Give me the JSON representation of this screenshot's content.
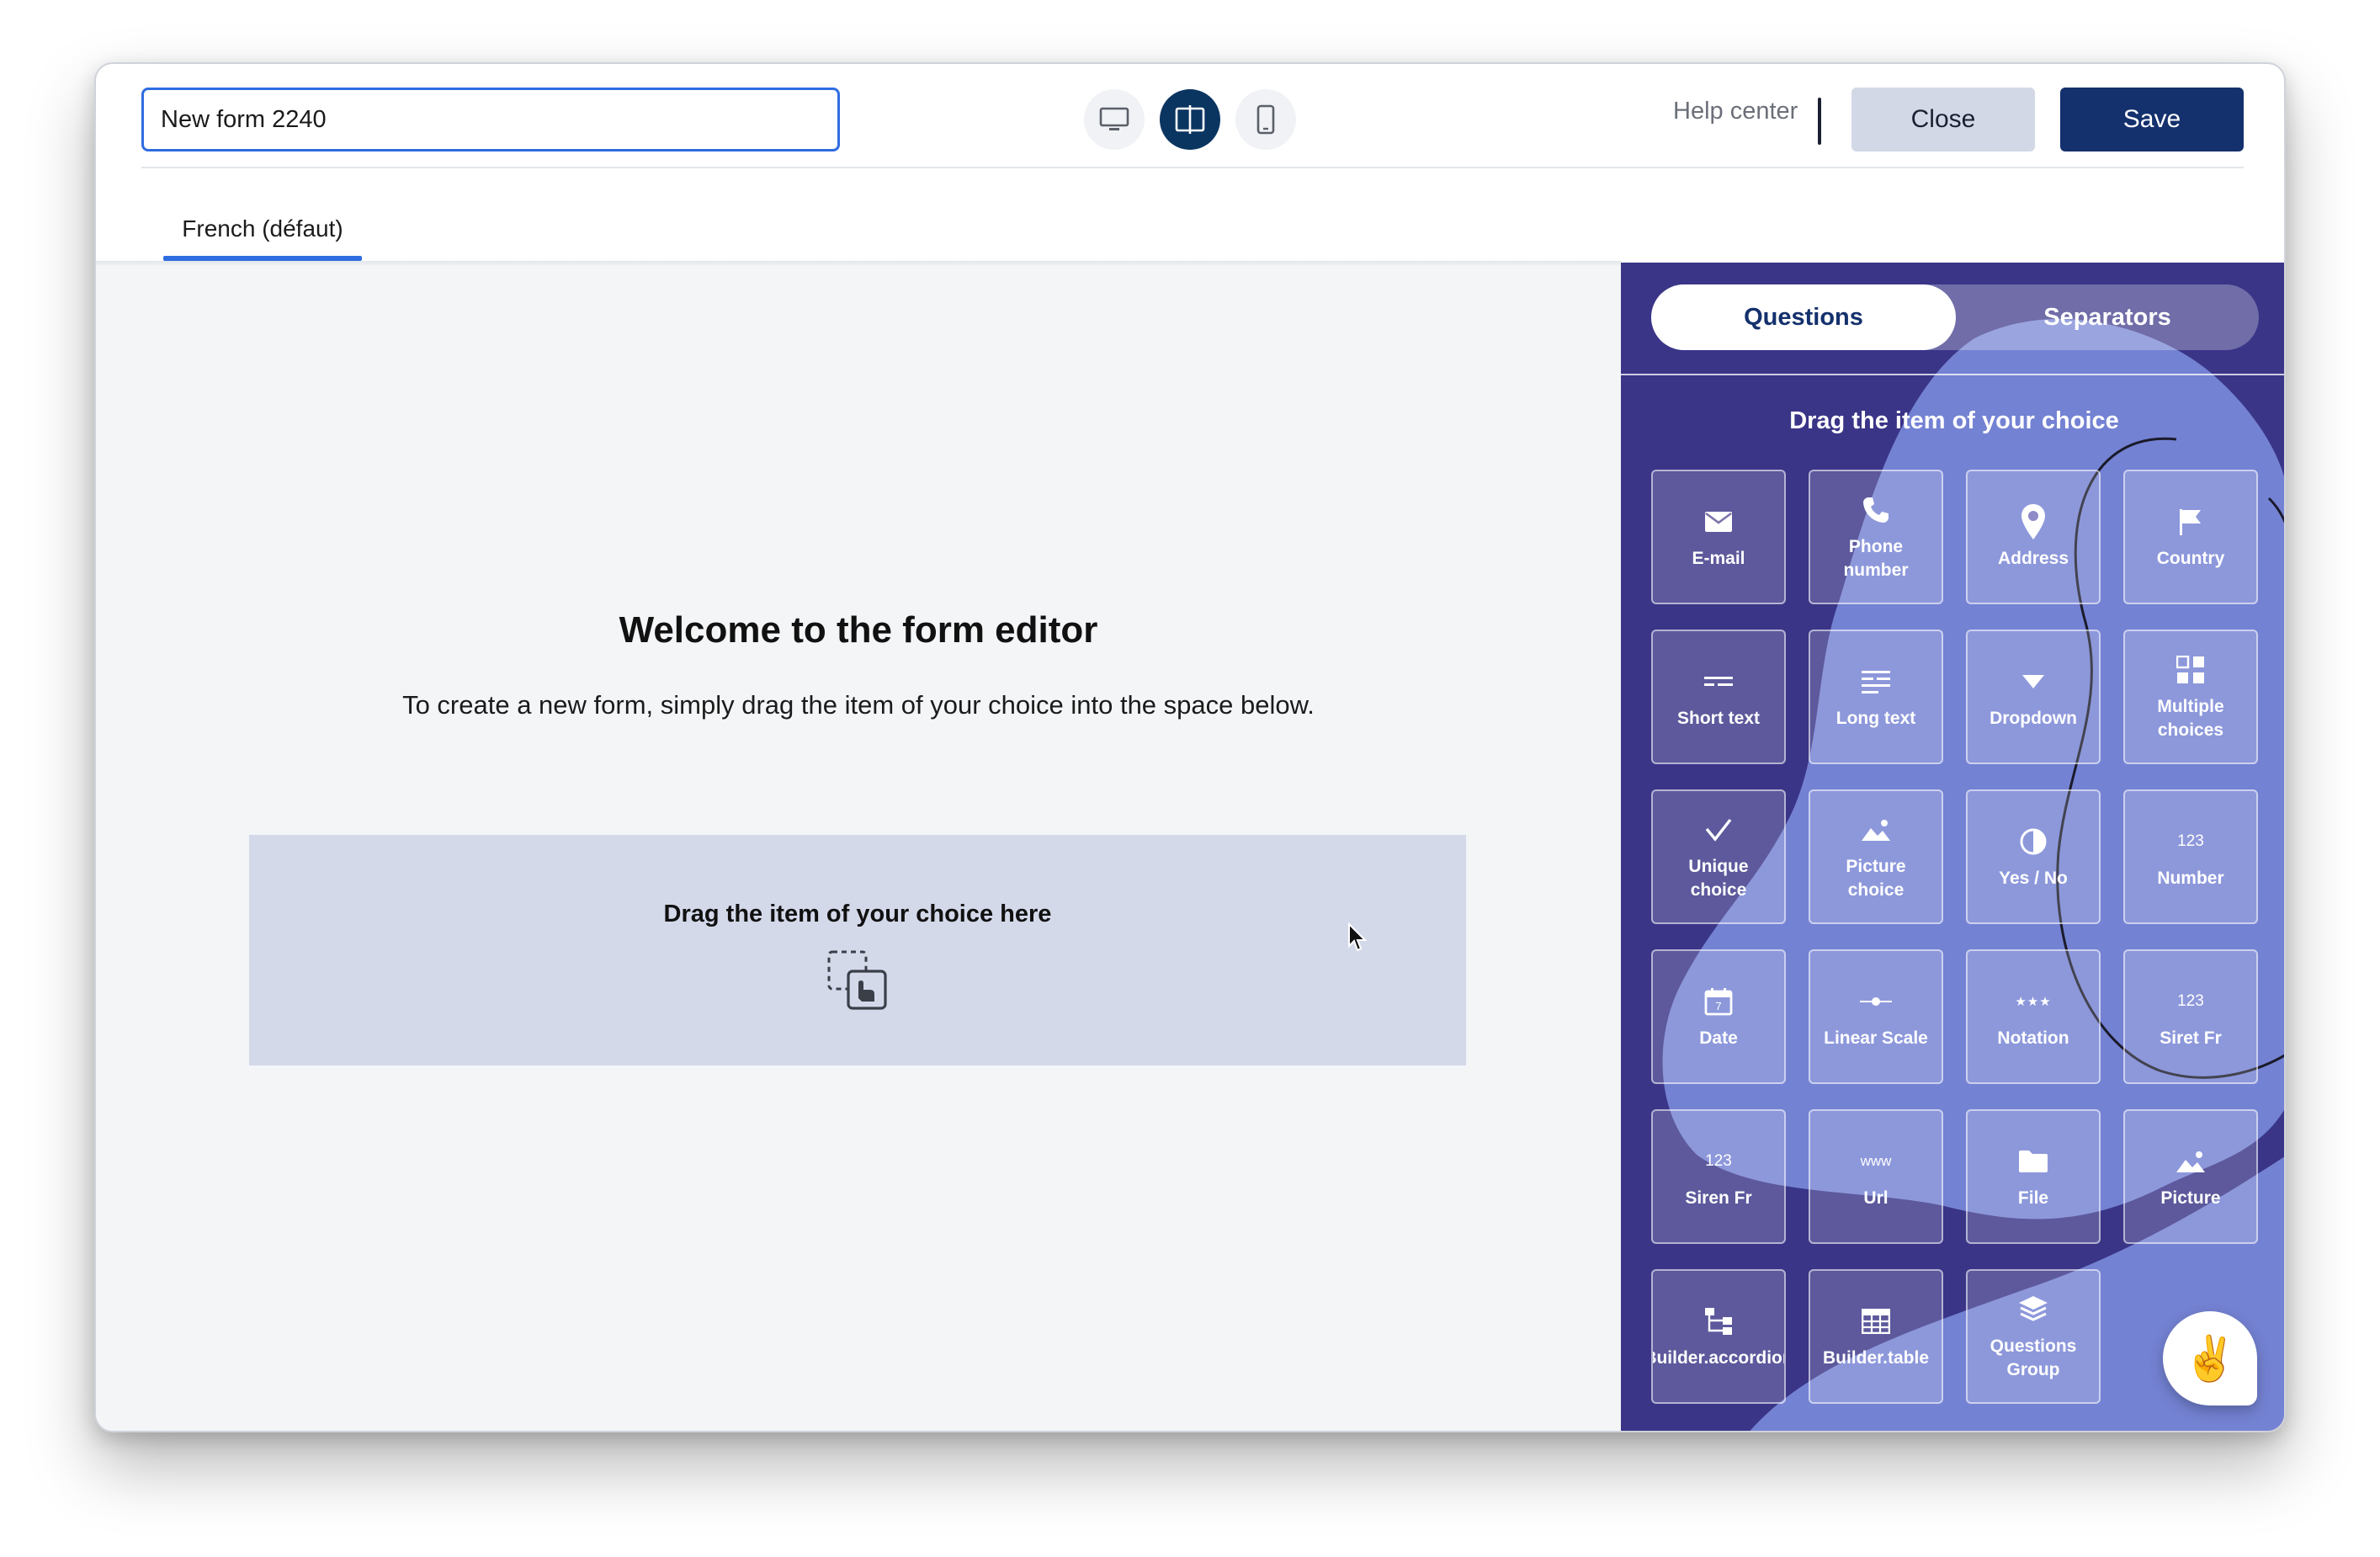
{
  "form": {
    "title_value": "New form 2240"
  },
  "header": {
    "help_label": "Help center",
    "close_label": "Close",
    "save_label": "Save",
    "view_modes": [
      "desktop-icon",
      "split-view-icon",
      "mobile-icon"
    ],
    "active_view": "split-view-icon"
  },
  "language_tab": {
    "label": "French (défaut)"
  },
  "canvas": {
    "title": "Welcome to the form editor",
    "subtitle": "To create a new form, simply drag the item of your choice into the space below.",
    "dropzone_label": "Drag the item of your choice here"
  },
  "sidebar": {
    "tabs": [
      {
        "label": "Questions",
        "active": true
      },
      {
        "label": "Separators",
        "active": false
      }
    ],
    "heading": "Drag the item of your choice",
    "items": [
      {
        "label": "E-mail",
        "icon": "envelope-icon"
      },
      {
        "label": "Phone\nnumber",
        "icon": "phone-icon"
      },
      {
        "label": "Address",
        "icon": "location-pin-icon"
      },
      {
        "label": "Country",
        "icon": "flag-icon"
      },
      {
        "label": "Short text",
        "icon": "short-text-icon"
      },
      {
        "label": "Long text",
        "icon": "long-text-icon"
      },
      {
        "label": "Dropdown",
        "icon": "caret-down-icon"
      },
      {
        "label": "Multiple\nchoices",
        "icon": "grid-choices-icon"
      },
      {
        "label": "Unique\nchoice",
        "icon": "checkmark-icon"
      },
      {
        "label": "Picture\nchoice",
        "icon": "picture-icon"
      },
      {
        "label": "Yes / No",
        "icon": "half-circle-icon"
      },
      {
        "label": "Number",
        "icon": "number-icon",
        "glyph": "123"
      },
      {
        "label": "Date",
        "icon": "calendar-icon",
        "glyph": "7"
      },
      {
        "label": "Linear Scale",
        "icon": "linear-scale-icon"
      },
      {
        "label": "Notation",
        "icon": "stars-icon",
        "glyph": "★★★"
      },
      {
        "label": "Siret Fr",
        "icon": "number-icon",
        "glyph": "123"
      },
      {
        "label": "Siren Fr",
        "icon": "number-icon",
        "glyph": "123"
      },
      {
        "label": "Url",
        "icon": "www-icon",
        "glyph": "www"
      },
      {
        "label": "File",
        "icon": "folder-icon"
      },
      {
        "label": "Picture",
        "icon": "picture-icon"
      },
      {
        "label": "Builder.accordion",
        "icon": "tree-icon"
      },
      {
        "label": "Builder.table",
        "icon": "table-icon"
      },
      {
        "label": "Questions\nGroup",
        "icon": "layers-icon"
      }
    ]
  },
  "assistant_button": {
    "emoji": "✌️"
  },
  "colors": {
    "accent": "#2f6de0",
    "save_bg": "#14306d",
    "close_bg": "#d3d8e6",
    "sidebar_bg": "#3a3587",
    "dropzone_bg": "#d4d9ea"
  }
}
